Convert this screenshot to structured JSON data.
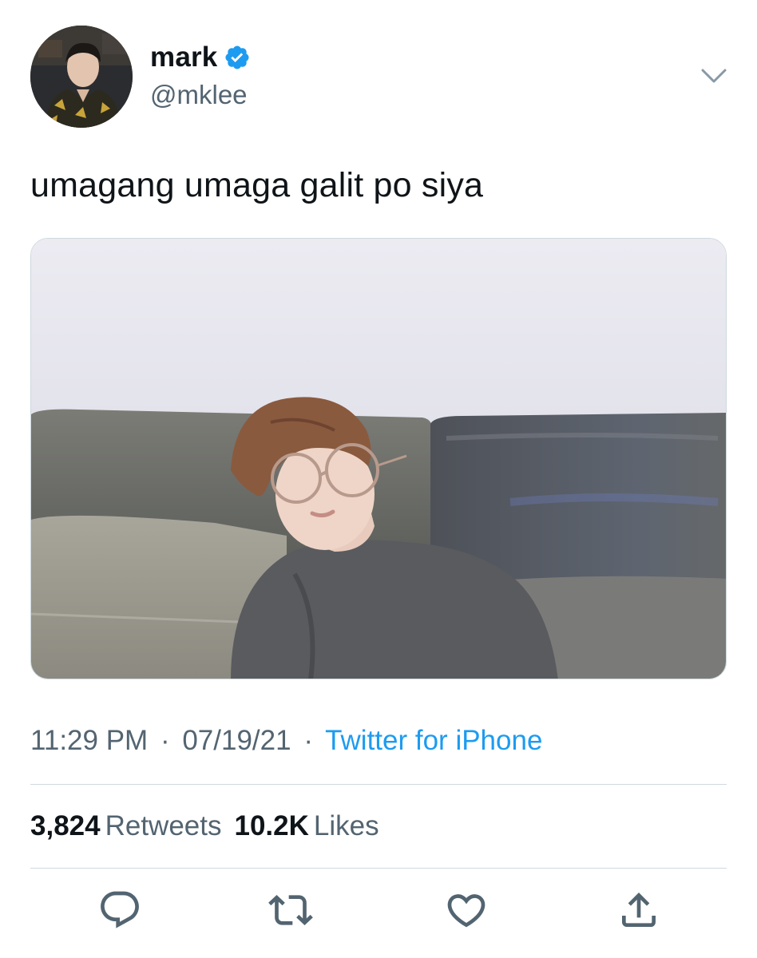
{
  "author": {
    "display_name": "mark",
    "handle": "@mklee",
    "verified": true
  },
  "tweet": {
    "text": "umagang umaga galit po siya",
    "time": "11:29 PM",
    "separator": "·",
    "date": "07/19/21",
    "source": "Twitter for iPhone"
  },
  "stats": {
    "retweets_count": "3,824",
    "retweets_label": "Retweets",
    "likes_count": "10.2K",
    "likes_label": "Likes"
  },
  "icons": {
    "verified": "verified-badge-icon",
    "more": "chevron-down-icon",
    "reply": "reply-bubble-icon",
    "retweet": "retweet-icon",
    "like": "heart-icon",
    "share": "share-icon"
  },
  "colors": {
    "accent": "#1d9bf0",
    "text": "#0f1419",
    "secondary": "#536471",
    "divider": "#cfd9de"
  }
}
